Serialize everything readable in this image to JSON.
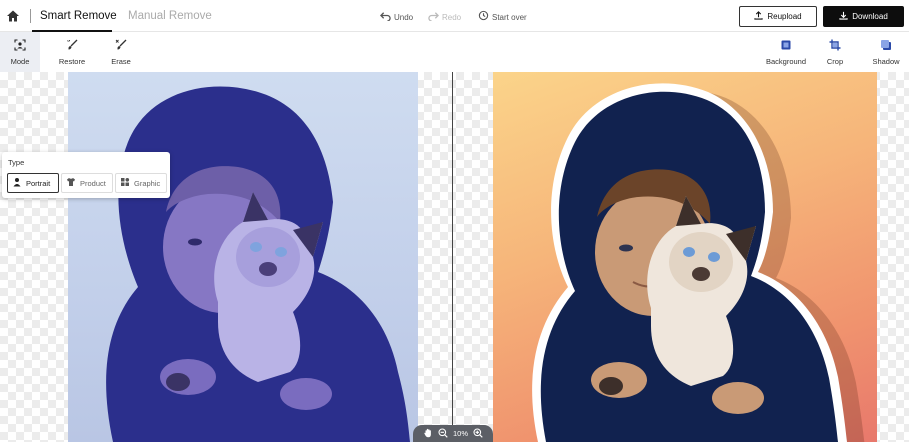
{
  "header": {
    "active_mode": "Smart Remove",
    "inactive_mode": "Manual Remove",
    "undo": "Undo",
    "redo": "Redo",
    "start_over": "Start over",
    "reupload": "Reupload",
    "download": "Download"
  },
  "toolbar": {
    "mode": "Mode",
    "restore": "Restore",
    "erase": "Erase",
    "background": "Background",
    "crop": "Crop",
    "shadow": "Shadow"
  },
  "type_panel": {
    "title": "Type",
    "options": [
      "Portrait",
      "Product",
      "Graphic"
    ],
    "selected": "Portrait"
  },
  "zoom": {
    "level": "10%"
  },
  "icons": {
    "home": "home-icon",
    "undo": "undo-icon",
    "redo": "redo-icon",
    "start_over": "history-icon",
    "reupload": "upload-icon",
    "download": "download-icon",
    "mode": "scan-person-icon",
    "restore": "brush-icon",
    "erase": "eraser-icon",
    "background": "background-icon",
    "crop": "crop-icon",
    "shadow": "shadow-icon",
    "hand": "hand-icon",
    "zoom_out": "zoom-out-icon",
    "zoom_in": "zoom-in-icon"
  },
  "colors": {
    "primary_button": "#0d0d0d",
    "right_bg_top": "#fbd48a",
    "right_bg_bottom": "#e8786c"
  }
}
